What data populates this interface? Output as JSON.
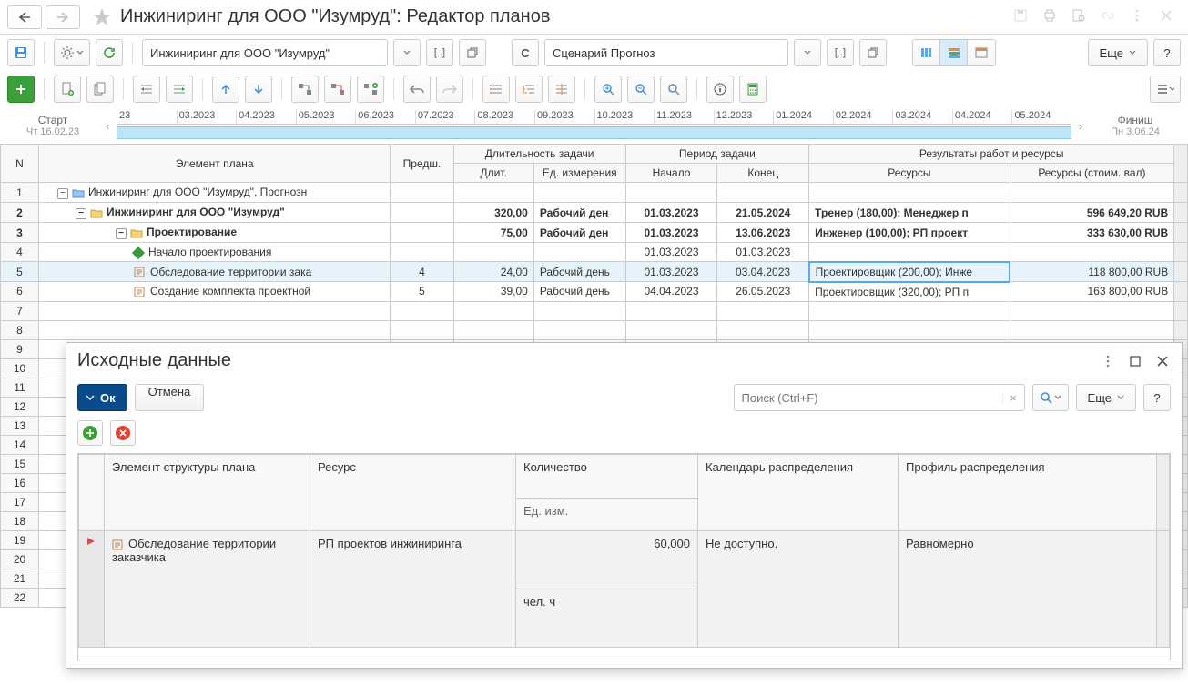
{
  "title": "Инжиниринг для ООО \"Изумруд\": Редактор планов",
  "toolbar": {
    "project_combo": "Инжиниринг для ООО \"Изумруд\"",
    "scenario_label": "С",
    "scenario_combo": "Сценарий Прогноз",
    "more_label": "Еще",
    "help_label": "?"
  },
  "timeline": {
    "start_label": "Старт",
    "start_date": "Чт 16.02.23",
    "finish_label": "Финиш",
    "finish_date": "Пн 3.06.24",
    "ticks": [
      "23",
      "03.2023",
      "04.2023",
      "05.2023",
      "06.2023",
      "07.2023",
      "08.2023",
      "09.2023",
      "10.2023",
      "11.2023",
      "12.2023",
      "01.2024",
      "02.2024",
      "03.2024",
      "04.2024",
      "05.2024"
    ]
  },
  "grid": {
    "headers": {
      "n": "N",
      "element": "Элемент плана",
      "pred": "Предш.",
      "dur_group": "Длительность задачи",
      "dur": "Длит.",
      "dur_unit": "Ед. измерения",
      "period_group": "Период задачи",
      "start": "Начало",
      "end": "Конец",
      "results_group": "Результаты работ и ресурсы",
      "resources": "Ресурсы",
      "resources_cost": "Ресурсы (стоим. вал)"
    },
    "rows": [
      {
        "n": "1",
        "text": "Инжиниринг для ООО \"Изумруд\", Прогнозн",
        "indent": 1,
        "icon": "folder-blue",
        "toggle": "-"
      },
      {
        "n": "2",
        "text": "Инжиниринг для ООО \"Изумруд\"",
        "indent": 2,
        "icon": "folder",
        "toggle": "-",
        "bold": true,
        "dur": "320,00",
        "unit": "Рабочий ден",
        "start": "01.03.2023",
        "end": "21.05.2024",
        "res": "Тренер (180,00); Менеджер п",
        "cost": "596 649,20 RUB"
      },
      {
        "n": "3",
        "text": "Проектирование",
        "indent": 3,
        "icon": "folder",
        "toggle": "-",
        "bold": true,
        "dur": "75,00",
        "unit": "Рабочий ден",
        "start": "01.03.2023",
        "end": "13.06.2023",
        "res": "Инженер (100,00); РП проект",
        "cost": "333 630,00 RUB"
      },
      {
        "n": "4",
        "text": "Начало проектирования",
        "indent": 4,
        "icon": "diamond",
        "start": "01.03.2023",
        "end": "01.03.2023"
      },
      {
        "n": "5",
        "text": "Обследование территории зака",
        "indent": 4,
        "icon": "doc",
        "pred": "4",
        "dur": "24,00",
        "unit": "Рабочий день",
        "start": "01.03.2023",
        "end": "03.04.2023",
        "res": "Проектировщик (200,00); Инже",
        "cost": "118 800,00 RUB",
        "selected": true
      },
      {
        "n": "6",
        "text": "Создание комплекта проектной",
        "indent": 4,
        "icon": "doc",
        "pred": "5",
        "dur": "39,00",
        "unit": "Рабочий день",
        "start": "04.04.2023",
        "end": "26.05.2023",
        "res": "Проектировщик (320,00); РП п",
        "cost": "163 800,00 RUB"
      }
    ],
    "blank_rows": [
      "7",
      "8",
      "9",
      "10",
      "11",
      "12",
      "13",
      "14",
      "15",
      "16",
      "17",
      "18",
      "19",
      "20",
      "21",
      "22"
    ]
  },
  "modal": {
    "title": "Исходные данные",
    "ok": "Ок",
    "cancel": "Отмена",
    "search_placeholder": "Поиск (Ctrl+F)",
    "more": "Еще",
    "help": "?",
    "headers": {
      "element": "Элемент структуры плана",
      "resource": "Ресурс",
      "qty": "Количество",
      "qty_unit": "Ед. изм.",
      "calendar": "Календарь распределения",
      "profile": "Профиль распределения"
    },
    "row": {
      "element": "Обследование территории заказчика",
      "resource": "РП проектов инжиниринга",
      "qty": "60,000",
      "unit": "чел. ч",
      "calendar": "Не доступно.",
      "profile": "Равномерно"
    }
  }
}
